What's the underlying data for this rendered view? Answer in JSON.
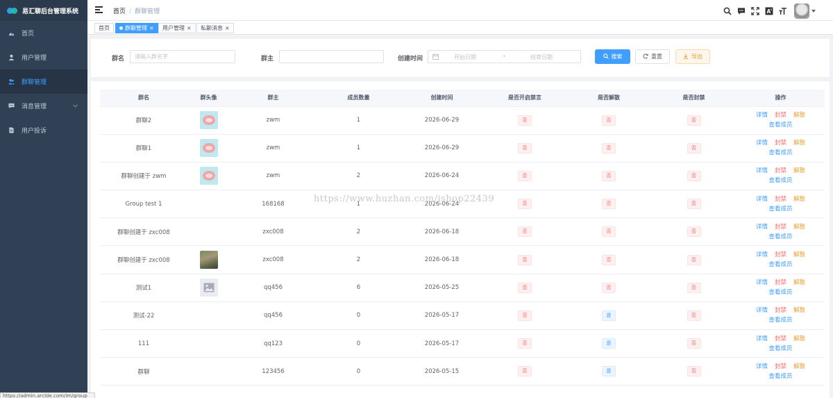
{
  "app": {
    "title": "易汇聊后台管理系统"
  },
  "sidebar": {
    "items": [
      {
        "label": "首页",
        "icon": "dashboard-icon",
        "active": false
      },
      {
        "label": "用户管理",
        "icon": "user-icon",
        "active": false
      },
      {
        "label": "群聊管理",
        "icon": "users-icon",
        "active": true
      },
      {
        "label": "消息管理",
        "icon": "message-icon",
        "active": false,
        "expandable": true
      },
      {
        "label": "用户投诉",
        "icon": "document-icon",
        "active": false
      }
    ]
  },
  "header": {
    "breadcrumb": {
      "home": "首页",
      "separator": "/",
      "current": "群聊管理"
    },
    "tools": [
      "search-icon",
      "chat-icon",
      "fullscreen-icon",
      "translate-icon",
      "font-size-icon"
    ]
  },
  "tags": [
    {
      "label": "首页",
      "active": false,
      "closable": false
    },
    {
      "label": "群聊管理",
      "active": true,
      "closable": true
    },
    {
      "label": "用户管理",
      "active": false,
      "closable": true
    },
    {
      "label": "私聊消息",
      "active": false,
      "closable": true
    }
  ],
  "filters": {
    "group_name": {
      "label": "群名",
      "placeholder": "请输入群名字",
      "value": ""
    },
    "owner": {
      "label": "群主",
      "placeholder": "",
      "value": ""
    },
    "created_time": {
      "label": "创建时间",
      "start_placeholder": "开始日期",
      "separator": "-",
      "end_placeholder": "结束日期"
    },
    "buttons": {
      "search": "搜索",
      "reset": "重置",
      "export": "导出"
    }
  },
  "table": {
    "columns": [
      "群名",
      "群头像",
      "群主",
      "成员数量",
      "创建时间",
      "是否开启禁言",
      "是否解散",
      "是否封禁",
      "操作"
    ],
    "actions": {
      "detail": "详情",
      "ban": "封禁",
      "dissolve": "解散",
      "members": "查看成员"
    },
    "rows": [
      {
        "name": "群聊2",
        "avatar": "cartoon",
        "owner": "zwm",
        "members": "1",
        "created": "2026-06-29",
        "muted": "否",
        "dissolved": "否",
        "banned": "否"
      },
      {
        "name": "群聊1",
        "avatar": "cartoon",
        "owner": "zwm",
        "members": "1",
        "created": "2026-06-29",
        "muted": "否",
        "dissolved": "否",
        "banned": "否"
      },
      {
        "name": "群聊创建于 zwm",
        "avatar": "cartoon",
        "owner": "zwm",
        "members": "2",
        "created": "2026-06-24",
        "muted": "否",
        "dissolved": "否",
        "banned": "否"
      },
      {
        "name": "Group test 1",
        "avatar": "none",
        "owner": "168168",
        "members": "1",
        "created": "2026-06-24",
        "muted": "否",
        "dissolved": "否",
        "banned": "否"
      },
      {
        "name": "群聊创建于 zxc008",
        "avatar": "none",
        "owner": "zxc008",
        "members": "2",
        "created": "2026-06-18",
        "muted": "否",
        "dissolved": "否",
        "banned": "否"
      },
      {
        "name": "群聊创建于 zxc008",
        "avatar": "photo",
        "owner": "zxc008",
        "members": "2",
        "created": "2026-06-18",
        "muted": "否",
        "dissolved": "否",
        "banned": "否"
      },
      {
        "name": "测试1",
        "avatar": "placeholder",
        "owner": "qq456",
        "members": "6",
        "created": "2026-05-25",
        "muted": "否",
        "dissolved": "否",
        "banned": "否"
      },
      {
        "name": "测试-22",
        "avatar": "none",
        "owner": "qq456",
        "members": "0",
        "created": "2026-05-17",
        "muted": "否",
        "dissolved": "是",
        "banned": "否"
      },
      {
        "name": "111",
        "avatar": "none",
        "owner": "qq123",
        "members": "0",
        "created": "2026-05-17",
        "muted": "否",
        "dissolved": "是",
        "banned": "否"
      },
      {
        "name": "群聊",
        "avatar": "none",
        "owner": "123456",
        "members": "0",
        "created": "2026-05-15",
        "muted": "否",
        "dissolved": "是",
        "banned": "否"
      }
    ]
  },
  "watermark": "https://www.huzhan.com/ishop22439",
  "status_url": "https://admin.arclde.com/im/group",
  "colors": {
    "sidebar_bg": "#304156",
    "primary": "#409eff",
    "danger": "#f56c6c",
    "warning": "#e6a23c"
  }
}
